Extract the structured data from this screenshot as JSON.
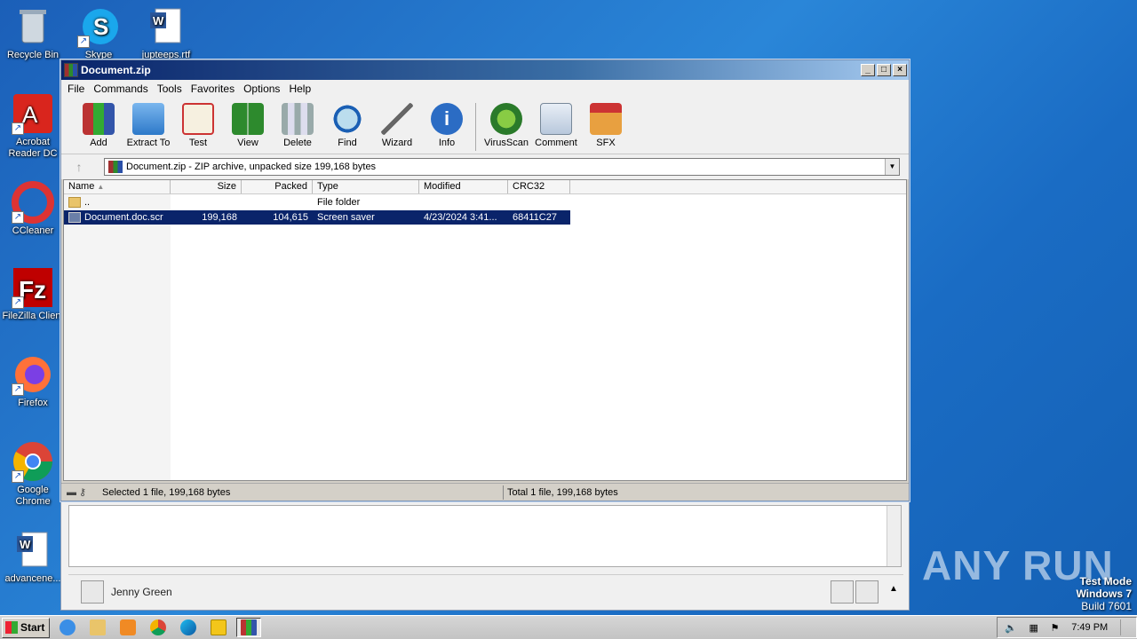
{
  "desktop": {
    "icons": [
      {
        "label": "Recycle Bin"
      },
      {
        "label": "Skype"
      },
      {
        "label": "jupteeps.rtf"
      },
      {
        "label": "Acrobat Reader DC"
      },
      {
        "label": "CCleaner"
      },
      {
        "label": "FileZilla Client"
      },
      {
        "label": "Firefox"
      },
      {
        "label": "Google Chrome"
      },
      {
        "label": "advancene..."
      }
    ]
  },
  "window": {
    "title": "Document.zip",
    "menu": [
      "File",
      "Commands",
      "Tools",
      "Favorites",
      "Options",
      "Help"
    ],
    "toolbar": [
      "Add",
      "Extract To",
      "Test",
      "View",
      "Delete",
      "Find",
      "Wizard",
      "Info",
      "VirusScan",
      "Comment",
      "SFX"
    ],
    "address": "Document.zip - ZIP archive, unpacked size 199,168 bytes",
    "columns": [
      "Name",
      "Size",
      "Packed",
      "Type",
      "Modified",
      "CRC32"
    ],
    "rows": [
      {
        "name": "..",
        "size": "",
        "packed": "",
        "type": "File folder",
        "modified": "",
        "crc": ""
      },
      {
        "name": "Document.doc.scr",
        "size": "199,168",
        "packed": "104,615",
        "type": "Screen saver",
        "modified": "4/23/2024 3:41...",
        "crc": "68411C27"
      }
    ],
    "status_left": "Selected 1 file, 199,168 bytes",
    "status_right": "Total 1 file, 199,168 bytes"
  },
  "back_panel": {
    "user_name": "Jenny Green"
  },
  "watermark": "ANY RUN",
  "testmode": {
    "line1": "Test Mode",
    "line2": "Windows 7",
    "line3": "Build 7601"
  },
  "taskbar": {
    "start_label": "Start",
    "time": "7:49 PM"
  }
}
